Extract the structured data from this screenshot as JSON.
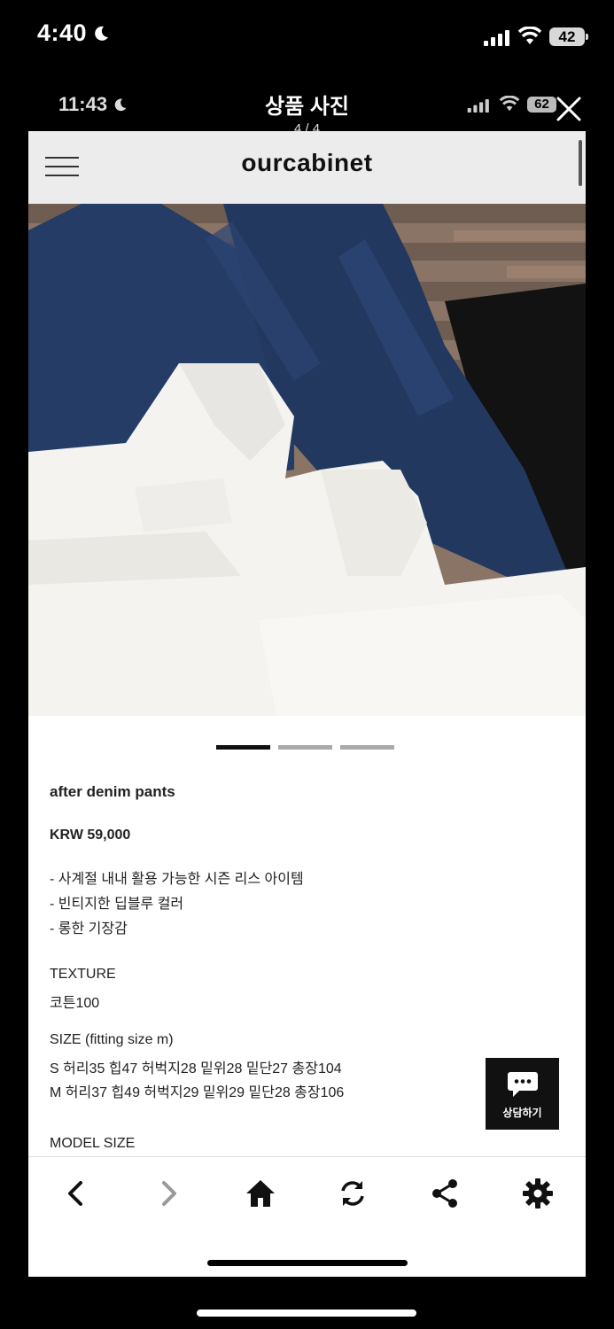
{
  "status_bar": {
    "time": "4:40",
    "battery": "42"
  },
  "viewer": {
    "inner_time": "11:43",
    "title": "상품 사진",
    "counter": "4 / 4",
    "inner_battery": "62"
  },
  "site": {
    "logo": "ourcabinet"
  },
  "carousel": {
    "pages": 3,
    "active_index": 0
  },
  "product": {
    "name": "after denim pants",
    "price": "KRW 59,000",
    "desc": [
      "- 사계절 내내 활용 가능한 시즌 리스 아이템",
      "- 빈티지한 딥블루 컬러",
      "- 롱한 기장감"
    ],
    "texture_label": "TEXTURE",
    "texture_value": "코튼100",
    "size_label": "SIZE (fitting size m)",
    "size_s": "S 허리35 힙47 허벅지28 밑위28 밑단27 총장104",
    "size_m": "M 허리37 힙49 허벅지29 밑위29 밑단28 총장106",
    "model_label": "MODEL SIZE"
  },
  "chat": {
    "label": "상담하기"
  },
  "colors": {
    "denim": "#23395f",
    "chat_bg": "#111111"
  },
  "icons": [
    "back-icon",
    "forward-icon",
    "home-icon",
    "refresh-icon",
    "share-icon",
    "gear-icon"
  ]
}
